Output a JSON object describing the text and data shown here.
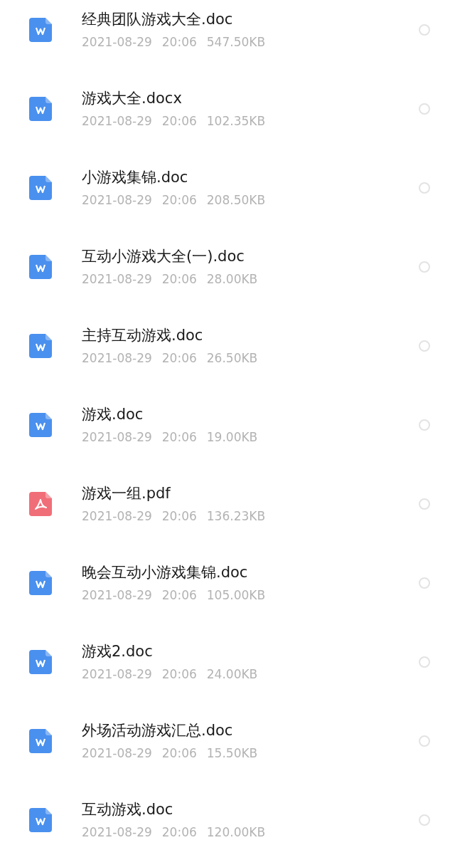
{
  "files": [
    {
      "kind": "doc",
      "name": "经典团队游戏大全.doc",
      "date": "2021-08-29",
      "time": "20:06",
      "size": "547.50KB",
      "selected": false
    },
    {
      "kind": "doc",
      "name": "游戏大全.docx",
      "date": "2021-08-29",
      "time": "20:06",
      "size": "102.35KB",
      "selected": false
    },
    {
      "kind": "doc",
      "name": "小游戏集锦.doc",
      "date": "2021-08-29",
      "time": "20:06",
      "size": "208.50KB",
      "selected": false
    },
    {
      "kind": "doc",
      "name": "互动小游戏大全(一).doc",
      "date": "2021-08-29",
      "time": "20:06",
      "size": "28.00KB",
      "selected": false
    },
    {
      "kind": "doc",
      "name": "主持互动游戏.doc",
      "date": "2021-08-29",
      "time": "20:06",
      "size": "26.50KB",
      "selected": false
    },
    {
      "kind": "doc",
      "name": "游戏.doc",
      "date": "2021-08-29",
      "time": "20:06",
      "size": "19.00KB",
      "selected": false
    },
    {
      "kind": "pdf",
      "name": "游戏一组.pdf",
      "date": "2021-08-29",
      "time": "20:06",
      "size": "136.23KB",
      "selected": false
    },
    {
      "kind": "doc",
      "name": "晚会互动小游戏集锦.doc",
      "date": "2021-08-29",
      "time": "20:06",
      "size": "105.00KB",
      "selected": false
    },
    {
      "kind": "doc",
      "name": "游戏2.doc",
      "date": "2021-08-29",
      "time": "20:06",
      "size": "24.00KB",
      "selected": false
    },
    {
      "kind": "doc",
      "name": "外场活动游戏汇总.doc",
      "date": "2021-08-29",
      "time": "20:06",
      "size": "15.50KB",
      "selected": false
    },
    {
      "kind": "doc",
      "name": "互动游戏.doc",
      "date": "2021-08-29",
      "time": "20:06",
      "size": "120.00KB",
      "selected": false
    }
  ]
}
